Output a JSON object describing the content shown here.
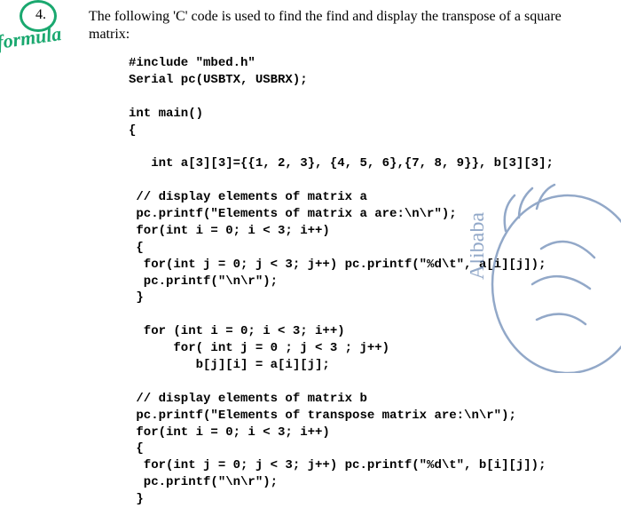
{
  "question": {
    "number": "4.",
    "text_line1": "The following 'C' code is used to find the find and display the transpose of a square",
    "text_line2": "matrix:"
  },
  "annotation": {
    "handwritten": "formula"
  },
  "code": "#include \"mbed.h\"\nSerial pc(USBTX, USBRX);\n\nint main()\n{\n\n   int a[3][3]={{1, 2, 3}, {4, 5, 6},{7, 8, 9}}, b[3][3];\n\n // display elements of matrix a\n pc.printf(\"Elements of matrix a are:\\n\\r\");\n for(int i = 0; i < 3; i++)\n {\n  for(int j = 0; j < 3; j++) pc.printf(\"%d\\t\", a[i][j]);\n  pc.printf(\"\\n\\r\");\n }\n\n  for (int i = 0; i < 3; i++)\n      for( int j = 0 ; j < 3 ; j++)\n         b[j][i] = a[i][j];\n\n // display elements of matrix b\n pc.printf(\"Elements of transpose matrix are:\\n\\r\");\n for(int i = 0; i < 3; i++)\n {\n  for(int j = 0; j < 3; j++) pc.printf(\"%d\\t\", b[i][j]);\n  pc.printf(\"\\n\\r\");\n }"
}
